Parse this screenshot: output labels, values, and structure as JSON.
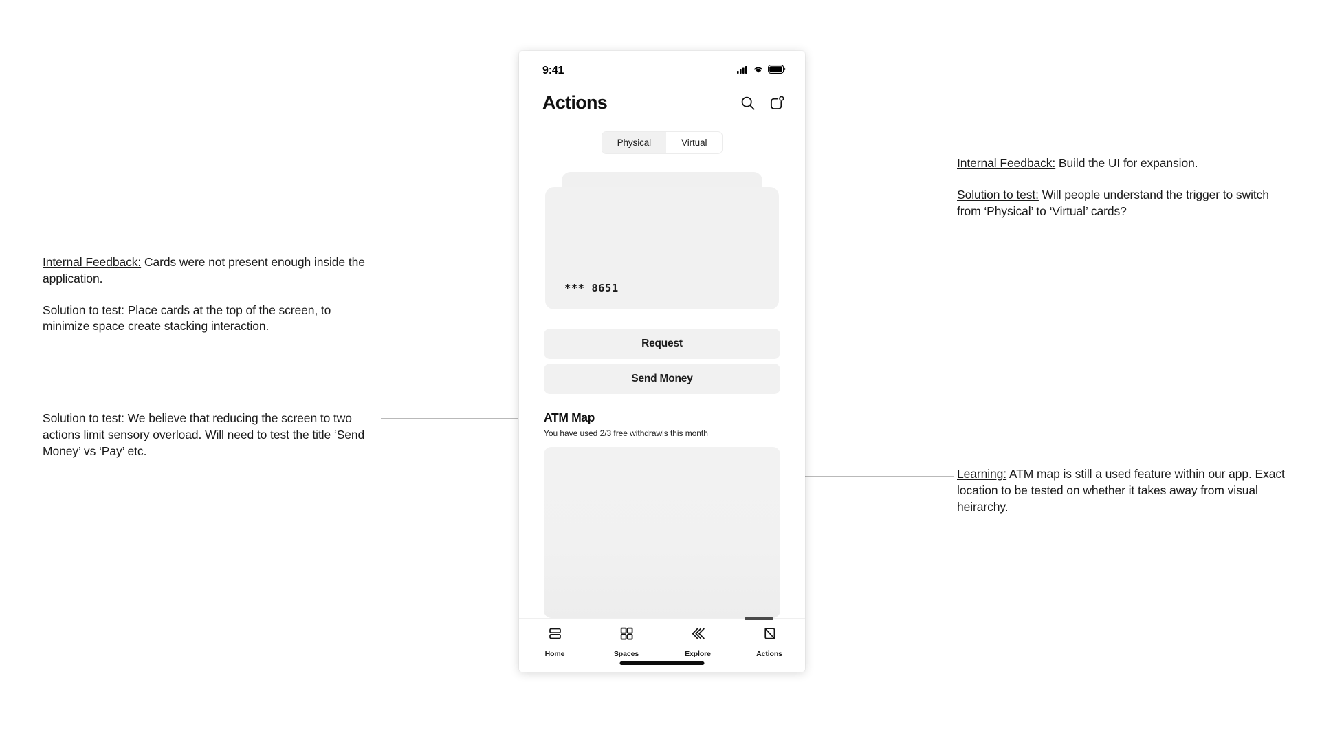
{
  "phone": {
    "status_bar": {
      "time": "9:41",
      "icons": [
        "cellular-signal-icon",
        "wifi-icon",
        "battery-icon"
      ]
    },
    "header": {
      "title": "Actions",
      "search_icon": "search-icon",
      "notifications_icon": "notification-icon",
      "notification_badge": true
    },
    "segmented_control": {
      "options": [
        {
          "label": "Physical",
          "selected": true
        },
        {
          "label": "Virtual",
          "selected": false
        }
      ]
    },
    "card": {
      "number": "*** 8651"
    },
    "actions": [
      {
        "label": "Request"
      },
      {
        "label": "Send Money"
      }
    ],
    "atm": {
      "title": "ATM Map",
      "subtitle": "You have used 2/3 free withdrawls this month"
    },
    "tab_bar": {
      "tabs": [
        {
          "label": "Home",
          "icon": "home-rows-icon"
        },
        {
          "label": "Spaces",
          "icon": "grid-icon"
        },
        {
          "label": "Explore",
          "icon": "layers-chevron-icon"
        },
        {
          "label": "Actions",
          "icon": "diagonal-square-icon"
        }
      ]
    }
  },
  "annotations": {
    "left_top": {
      "feedback_label": "Internal Feedback:",
      "feedback_text": " Cards were not present enough inside the application.",
      "solution_label": "Solution to test:",
      "solution_text": " Place cards at the top of the screen, to minimize space create stacking interaction."
    },
    "left_bottom": {
      "solution_label": "Solution to test:",
      "solution_text": " We believe that reducing the screen to two actions limit sensory overload. Will need to test the title ‘Send Money’ vs ‘Pay’ etc."
    },
    "right_top": {
      "feedback_label": "Internal Feedback:",
      "feedback_text": " Build the UI for expansion.",
      "solution_label": "Solution to test:",
      "solution_text": " Will people understand the trigger to switch from ‘Physical’ to ‘Virtual’ cards?"
    },
    "right_bottom": {
      "learning_label": "Learning:",
      "learning_text": " ATM map is still a used feature within our app. Exact location to be tested on whether it takes away from visual heirarchy."
    }
  },
  "colors": {
    "background": "#ffffff",
    "surface_grey": "#f1f1f1",
    "text": "#111111",
    "connector": "#b9b9b9"
  }
}
